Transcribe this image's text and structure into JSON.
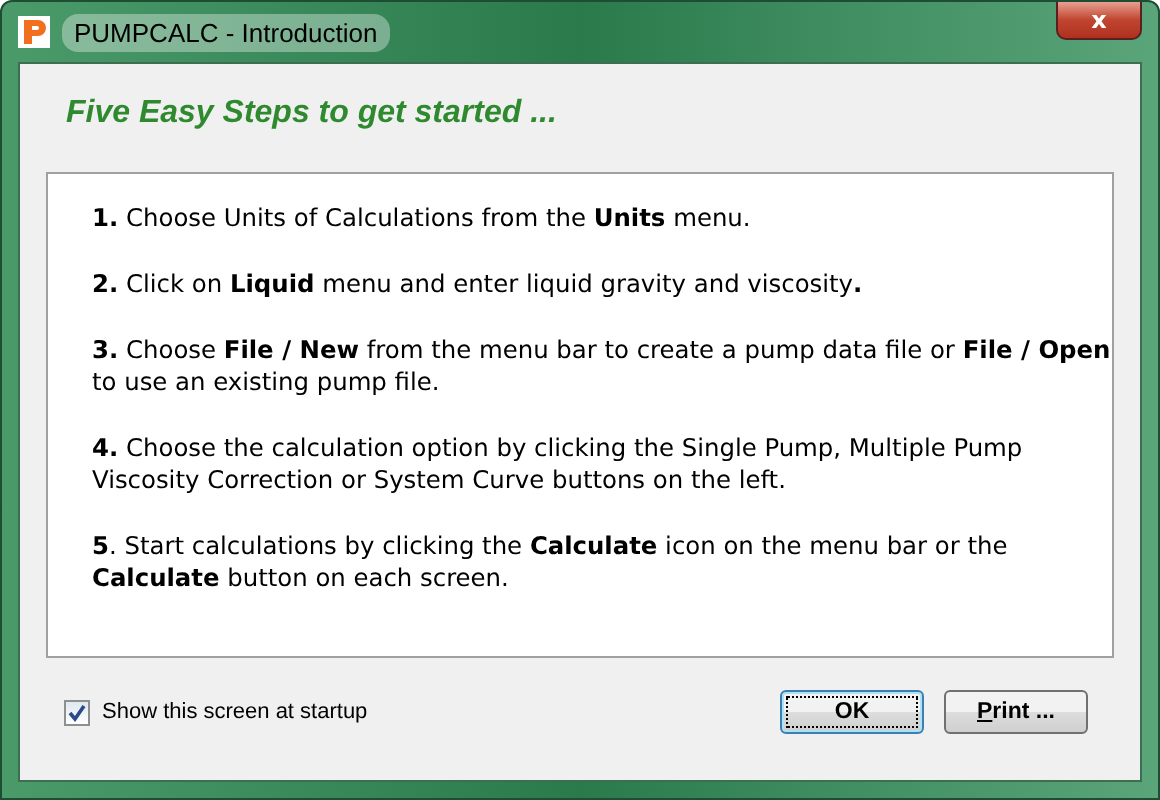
{
  "window": {
    "title": "PUMPCALC - Introduction",
    "close_label": "x"
  },
  "heading": "Five Easy Steps to get started ...",
  "steps": [
    "**1.** Choose Units of Calculations from the **Units** menu.",
    "**2.** Click on **Liquid** menu and enter liquid gravity and viscosity**.**",
    "**3.** Choose **File / New** from the menu bar to create a pump data file or **File / Open** to use an existing pump file.",
    "**4.** Choose the calculation option by clicking the Single Pump, Multiple Pump Viscosity Correction or System Curve buttons on the left.",
    "**5**. Start calculations by clicking the **Calculate** icon on the menu bar or the **Calculate** button on each screen."
  ],
  "startup_checkbox": {
    "label": "Show this screen at startup",
    "checked": true
  },
  "buttons": [
    {
      "label": "OK",
      "default": true
    },
    {
      "label": "Print ...",
      "default": false
    }
  ]
}
